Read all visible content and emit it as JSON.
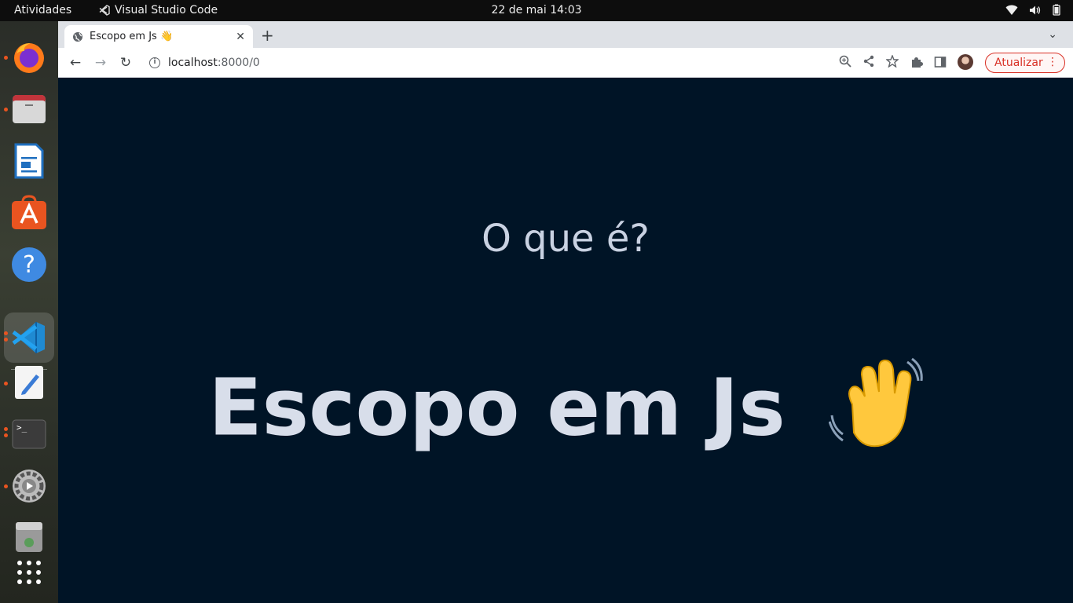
{
  "topbar": {
    "activities": "Atividades",
    "app_name": "Visual Studio Code",
    "clock": "22 de mai  14:03"
  },
  "dock": {
    "items": [
      {
        "name": "firefox",
        "running": true
      },
      {
        "name": "files",
        "running": true
      },
      {
        "name": "writer",
        "running": false
      },
      {
        "name": "software",
        "running": false
      },
      {
        "name": "help",
        "running": false
      },
      {
        "name": "vscode",
        "running": true,
        "active": true
      },
      {
        "name": "text-editor",
        "running": true
      },
      {
        "name": "terminal",
        "running": true
      },
      {
        "name": "settings",
        "running": true
      },
      {
        "name": "trash",
        "running": false
      },
      {
        "name": "app-grid",
        "running": false
      }
    ]
  },
  "browser": {
    "tab_title": "Escopo em Js 👋",
    "url_host": "localhost",
    "url_rest": ":8000/0",
    "update_label": "Atualizar"
  },
  "page": {
    "subtitle": "O que é?",
    "title": "Escopo em Js",
    "title_emoji": "👋"
  },
  "colors": {
    "page_bg": "#001426",
    "text": "#d8deea",
    "accent": "#e95420",
    "update": "#d93025"
  }
}
